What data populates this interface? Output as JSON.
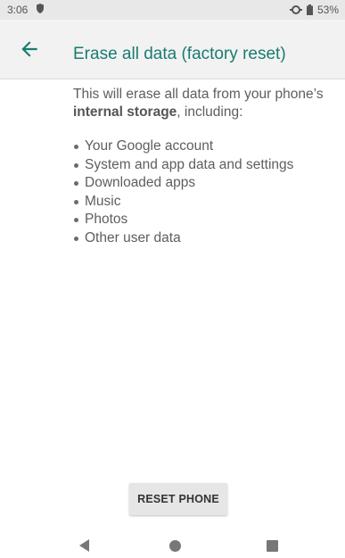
{
  "status_bar": {
    "time": "3:06",
    "battery_percent": "53%",
    "icons": [
      "shield-icon",
      "data-saver-icon",
      "battery-icon"
    ]
  },
  "header": {
    "title": "Erase all data (factory reset)",
    "back_icon": "arrow-left-icon"
  },
  "content": {
    "intro_prefix": "This will erase all data from your phone’s ",
    "intro_bold": "internal storage",
    "intro_suffix": ", including:",
    "items": [
      "Your Google account",
      "System and app data and settings",
      "Downloaded apps",
      "Music",
      "Photos",
      "Other user data"
    ]
  },
  "actions": {
    "reset_label": "RESET PHONE"
  },
  "nav_bar": {
    "icons": [
      "nav-back-icon",
      "nav-home-icon",
      "nav-recents-icon"
    ]
  },
  "colors": {
    "accent": "#1a7c70",
    "app_bar": "#f2f2f2",
    "status_bar": "#e8e8e8",
    "button_bg": "#e6e6e6"
  }
}
